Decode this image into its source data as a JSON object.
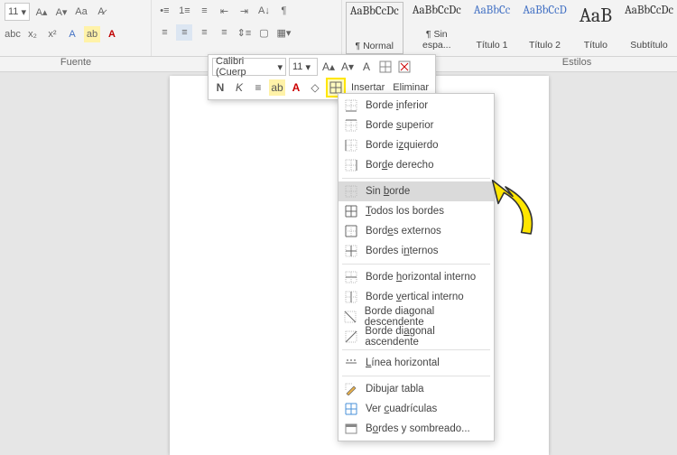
{
  "ribbon": {
    "fontSize": "11",
    "groupFont": "Fuente",
    "groupStyles": "Estilos"
  },
  "styles": [
    {
      "preview": "AaBbCcDc",
      "label": "¶ Normal",
      "cls": "normal",
      "blue": false,
      "big": false
    },
    {
      "preview": "AaBbCcDc",
      "label": "¶ Sin espa...",
      "cls": "",
      "blue": false,
      "big": false
    },
    {
      "preview": "AaBbCc",
      "label": "Título 1",
      "cls": "",
      "blue": true,
      "big": false
    },
    {
      "preview": "AaBbCcD",
      "label": "Título 2",
      "cls": "",
      "blue": true,
      "big": false
    },
    {
      "preview": "AaB",
      "label": "Título",
      "cls": "",
      "blue": false,
      "big": true
    },
    {
      "preview": "AaBbCcDc",
      "label": "Subtítulo",
      "cls": "",
      "blue": false,
      "big": false
    }
  ],
  "mini": {
    "font": "Calibri (Cuerp",
    "size": "11",
    "insert": "Insertar",
    "delete": "Eliminar"
  },
  "menu": {
    "items": [
      {
        "label": "Borde inferior",
        "accel": "i",
        "icon": "border-bottom"
      },
      {
        "label": "Borde superior",
        "accel": "s",
        "icon": "border-top"
      },
      {
        "label": "Borde izquierdo",
        "accel": "z",
        "icon": "border-left"
      },
      {
        "label": "Borde derecho",
        "accel": "d",
        "icon": "border-right"
      },
      {
        "sep": true
      },
      {
        "label": "Sin borde",
        "accel": "b",
        "icon": "border-none",
        "highlight": true
      },
      {
        "label": "Todos los bordes",
        "accel": "T",
        "icon": "border-all"
      },
      {
        "label": "Bordes externos",
        "accel": "e",
        "icon": "border-out"
      },
      {
        "label": "Bordes internos",
        "accel": "n",
        "icon": "border-in"
      },
      {
        "sep": true
      },
      {
        "label": "Borde horizontal interno",
        "accel": "h",
        "icon": "border-h"
      },
      {
        "label": "Borde vertical interno",
        "accel": "v",
        "icon": "border-v"
      },
      {
        "label": "Borde diagonal descendente",
        "accel": "g",
        "icon": "diag-down"
      },
      {
        "label": "Borde diagonal ascendente",
        "accel": "a",
        "icon": "diag-up"
      },
      {
        "sep": true
      },
      {
        "label": "Línea horizontal",
        "accel": "L",
        "icon": "hline"
      },
      {
        "sep": true
      },
      {
        "label": "Dibujar tabla",
        "accel": "j",
        "icon": "draw"
      },
      {
        "label": "Ver cuadrículas",
        "accel": "c",
        "icon": "grid"
      },
      {
        "label": "Bordes y sombreado...",
        "accel": "o",
        "icon": "dialog"
      }
    ]
  }
}
